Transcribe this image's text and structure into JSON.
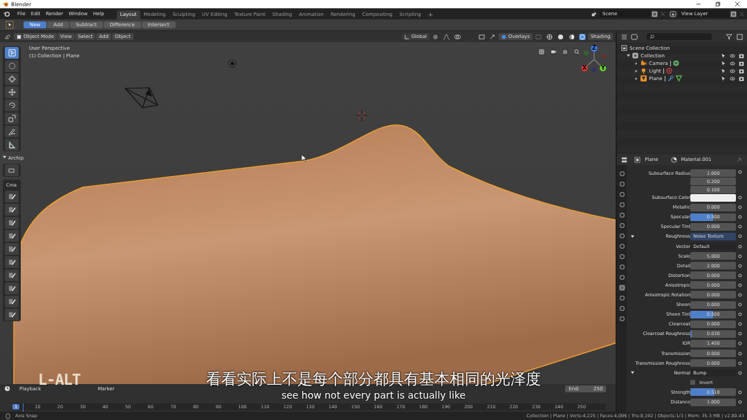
{
  "window": {
    "title": "Blender"
  },
  "menus": [
    "File",
    "Edit",
    "Render",
    "Window",
    "Help"
  ],
  "workspaces": [
    {
      "label": "Layout",
      "selected": true
    },
    {
      "label": "Modeling",
      "selected": false
    },
    {
      "label": "Sculpting",
      "selected": false
    },
    {
      "label": "UV Editing",
      "selected": false
    },
    {
      "label": "Texture Paint",
      "selected": false
    },
    {
      "label": "Shading",
      "selected": false
    },
    {
      "label": "Animation",
      "selected": false
    },
    {
      "label": "Rendering",
      "selected": false
    },
    {
      "label": "Compositing",
      "selected": false
    },
    {
      "label": "Scripting",
      "selected": false
    }
  ],
  "add_workspace": "+",
  "scene": "Scene",
  "view_layer": "View Layer",
  "tool_modes": [
    {
      "label": "New",
      "selected": true
    },
    {
      "label": "Add",
      "selected": false
    },
    {
      "label": "Subtract",
      "selected": false
    },
    {
      "label": "Difference",
      "selected": false
    },
    {
      "label": "Intersect",
      "selected": false
    }
  ],
  "viewport": {
    "mode": "Object Mode",
    "menus": [
      "View",
      "Select",
      "Add",
      "Object"
    ],
    "orientation": "Global",
    "overlays": "Overlays",
    "shading": "Shading",
    "info": [
      "User Perspective",
      "(1) Collection | Plane"
    ],
    "tools": [
      {
        "kind": "select",
        "selected": true
      },
      {
        "kind": "cursor",
        "selected": false
      },
      {
        "kind": "transform",
        "selected": false
      },
      {
        "kind": "move",
        "selected": false
      },
      {
        "kind": "rotate",
        "selected": false
      },
      {
        "kind": "scale",
        "selected": false
      },
      {
        "kind": "annotate",
        "selected": false
      },
      {
        "kind": "measure",
        "selected": false
      }
    ],
    "addon_panel": {
      "title": "Archip",
      "expanded": true,
      "section": "Crea"
    },
    "gizmo_axes": [
      "Z",
      "X",
      "Y"
    ]
  },
  "outliner": {
    "root": "Scene Collection",
    "items": [
      {
        "name": "Collection",
        "kind": "collection",
        "expanded": true,
        "children": [
          {
            "name": "Camera",
            "kind": "camera",
            "expanded": false
          },
          {
            "name": "Light",
            "kind": "light",
            "expanded": false
          },
          {
            "name": "Plane",
            "kind": "mesh",
            "expanded": false
          }
        ]
      }
    ]
  },
  "properties": {
    "object": "Plane",
    "material": "Material.001",
    "rows": [
      {
        "kind": "vector",
        "label": "Subsurface Radius",
        "values": [
          "1.000",
          "0.200",
          "0.100"
        ]
      },
      {
        "kind": "color",
        "label": "Subsurface Color",
        "color": "#eeeeee"
      },
      {
        "kind": "value",
        "label": "Metallic",
        "value": "0.000"
      },
      {
        "kind": "slider",
        "label": "Specular",
        "value": "0.500",
        "level": 0.5
      },
      {
        "kind": "value",
        "label": "Specular Tint",
        "value": "0.000"
      },
      {
        "kind": "link",
        "label": "Roughness",
        "value": "Noise Texture",
        "expanded": true,
        "highlighted": true
      },
      {
        "kind": "dropdown",
        "label": "Vector",
        "value": "Default"
      },
      {
        "kind": "value",
        "label": "Scale",
        "value": "5.000"
      },
      {
        "kind": "value",
        "label": "Detail",
        "value": "2.000"
      },
      {
        "kind": "value",
        "label": "Distortion",
        "value": "0.000"
      },
      {
        "kind": "value",
        "label": "Anisotropic",
        "value": "0.000"
      },
      {
        "kind": "value",
        "label": "Anisotropic Rotation",
        "value": "0.000"
      },
      {
        "kind": "value",
        "label": "Sheen",
        "value": "0.000"
      },
      {
        "kind": "slider",
        "label": "Sheen Tint",
        "value": "0.500",
        "level": 0.5
      },
      {
        "kind": "value",
        "label": "Clearcoat",
        "value": "0.000"
      },
      {
        "kind": "slider",
        "label": "Clearcoat Roughness",
        "value": "0.030",
        "level": 0.03
      },
      {
        "kind": "value",
        "label": "IOR",
        "value": "1.450"
      },
      {
        "kind": "value",
        "label": "Transmission",
        "value": "0.000"
      },
      {
        "kind": "value",
        "label": "Transmission Roughness",
        "value": "0.000"
      },
      {
        "kind": "link",
        "label": "Normal",
        "value": "Bump",
        "expanded": true,
        "highlighted": false
      },
      {
        "kind": "checkbox",
        "label": "Invert",
        "checked": false
      },
      {
        "kind": "slider",
        "label": "Strength",
        "value": "0.518",
        "level": 0.518
      },
      {
        "kind": "value",
        "label": "Distance",
        "value": "1.000"
      }
    ]
  },
  "timeline": {
    "menus": [
      "Playback",
      "Marker"
    ],
    "end_label": "End:",
    "end": "250",
    "current_frame": "1",
    "frames": [
      "10",
      "20",
      "30",
      "40",
      "50",
      "60",
      "70",
      "80",
      "90",
      "100",
      "110",
      "120",
      "130",
      "140",
      "150",
      "160",
      "170",
      "180",
      "190",
      "200",
      "210",
      "220",
      "230",
      "240",
      "250"
    ]
  },
  "key_overlay": "L-ALT",
  "subtitles": {
    "zh": "看看实际上不是每个部分都具有基本相同的光泽度",
    "en": "see how not every part is actually like"
  },
  "status_bar": {
    "hint": "Axis Snap",
    "stats": "Collection | Plane | Verts:4,225 | Faces:4,096 | Tris:8,192 | Objects:1/3 | Mem: 35.3 MB | v2.80.43"
  }
}
